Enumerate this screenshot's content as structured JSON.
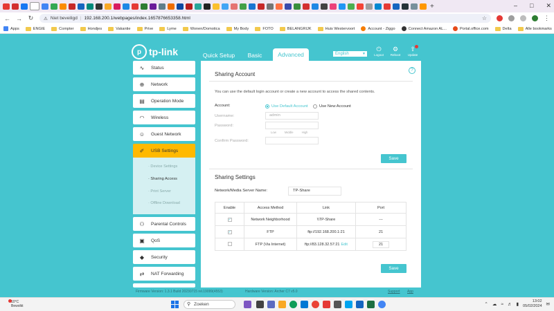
{
  "browser": {
    "security_label": "Niet beveiligd",
    "url": "192.168.200.1/webpages/index.1657876653358.html",
    "new_tab": "+",
    "window_controls": [
      "–",
      "□",
      "✕"
    ],
    "bookmarks": [
      {
        "label": "Apps",
        "icon": "apps-grid-icon"
      },
      {
        "label": "ENGIE",
        "icon": "folder-icon"
      },
      {
        "label": "Compter",
        "icon": "folder-icon"
      },
      {
        "label": "Hondjes",
        "icon": "folder-icon"
      },
      {
        "label": "Vakantie",
        "icon": "folder-icon"
      },
      {
        "label": "Prive",
        "icon": "folder-icon"
      },
      {
        "label": "Lyme",
        "icon": "folder-icon"
      },
      {
        "label": "Wonen/Domotica",
        "icon": "folder-icon"
      },
      {
        "label": "My Body",
        "icon": "folder-icon"
      },
      {
        "label": "FOTO",
        "icon": "folder-icon"
      },
      {
        "label": "BELANGRIJK",
        "icon": "folder-icon"
      },
      {
        "label": "Huis Westervoort",
        "icon": "folder-icon"
      },
      {
        "label": "Account - Ziggo",
        "icon": "ziggo-icon"
      },
      {
        "label": "Connect Amazon AL...",
        "icon": "amazon-icon"
      },
      {
        "label": "Portal.office.com",
        "icon": "office-icon"
      },
      {
        "label": "Delta",
        "icon": "folder-icon"
      }
    ],
    "all_bookmarks": "Alle bookmarks"
  },
  "router": {
    "logo_text": "tp-link",
    "tabs": {
      "quick": "Quick Setup",
      "basic": "Basic",
      "advanced": "Advanced"
    },
    "language": "English",
    "header_buttons": {
      "logout": "Logout",
      "reboot": "Reboot",
      "update": "Update"
    },
    "sidebar": [
      {
        "label": "Status",
        "icon": "status-pulse-icon",
        "glyph": "∿"
      },
      {
        "label": "Network",
        "icon": "globe-icon",
        "glyph": "⊕"
      },
      {
        "label": "Operation Mode",
        "icon": "operation-mode-icon",
        "glyph": "▤"
      },
      {
        "label": "Wireless",
        "icon": "wifi-icon",
        "glyph": "◠"
      },
      {
        "label": "Guest Network",
        "icon": "guest-user-icon",
        "glyph": "☺"
      },
      {
        "label": "USB Settings",
        "icon": "usb-icon",
        "glyph": "✐"
      },
      {
        "label": "Parental Controls",
        "icon": "parental-icon",
        "glyph": "⚇"
      },
      {
        "label": "QoS",
        "icon": "qos-icon",
        "glyph": "▣"
      },
      {
        "label": "Security",
        "icon": "shield-icon",
        "glyph": "◆"
      },
      {
        "label": "NAT Forwarding",
        "icon": "nat-icon",
        "glyph": "⇄"
      }
    ],
    "usb_sub": [
      {
        "label": "·  Device Settings"
      },
      {
        "label": "·  Sharing Access"
      },
      {
        "label": "·  Print Server"
      },
      {
        "label": "·  Offline Download"
      }
    ],
    "sharing_account": {
      "title": "Sharing Account",
      "description": "You can use the default login account or create a new account to access the shared contents.",
      "account_label": "Account:",
      "option_default": "Use Default Account",
      "option_new": "Use New Account",
      "username_label": "Username:",
      "username_value": "admin",
      "password_label": "Password:",
      "strength": [
        "Low",
        "Middle",
        "High"
      ],
      "confirm_label": "Confirm Password:",
      "save": "Save"
    },
    "sharing_settings": {
      "title": "Sharing Settings",
      "server_label": "Network/Media Server Name:",
      "server_value": "TP-Share",
      "columns": [
        "Enable",
        "Access Method",
        "Link",
        "Port"
      ],
      "rows": [
        {
          "enabled": true,
          "method": "Network Neighborhood",
          "link": "\\\\TP-Share",
          "port": "---"
        },
        {
          "enabled": true,
          "method": "FTP",
          "link": "ftp://192.168.200.1:21",
          "port": "21"
        },
        {
          "enabled": false,
          "method": "FTP (Via Internet)",
          "link": "ftp://83.128.32.57:21",
          "port": "21",
          "edit": "Edit"
        }
      ],
      "save": "Save"
    },
    "footer": {
      "firmware": "Firmware Version: 1.3.1 Build 20230715 rel.19099(4553)",
      "hardware": "Hardware Version: Archer C7 v5.0",
      "support": "Support",
      "app": "App"
    }
  },
  "taskbar": {
    "weather_temp": "10°C",
    "weather_desc": "Bewolkt",
    "search": "Zoeken",
    "time": "13:02",
    "date": "05/02/2024"
  }
}
